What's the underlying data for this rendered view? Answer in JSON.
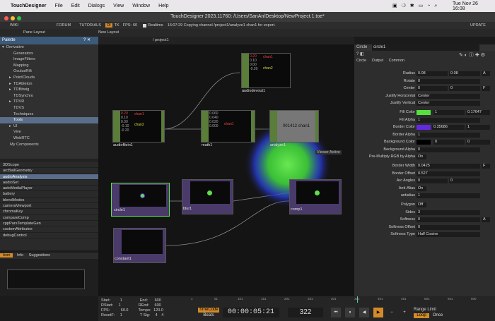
{
  "menubar": {
    "app": "TouchDesigner",
    "items": [
      "File",
      "Edit",
      "Dialogs",
      "View",
      "Window",
      "Help"
    ],
    "datetime": "Tue Nov 26  16:08"
  },
  "title": "TouchDesigner 2023.11760: /Users/SanAn/Desktop/NewProject.1.toe*",
  "toolbar": {
    "wiki": "WIKI",
    "forum": "FORUM",
    "tutorials": "TUTORIALS",
    "oi": "OI",
    "tk": "TK",
    "fps_label": "FPS:",
    "fps": "60",
    "realtime": "Realtime",
    "status": "16:07:29 Copying channel /project1/analyze1 chan1 for export.",
    "update": "UPDATE"
  },
  "toolbar2": {
    "pane_layout": "Pane Layout",
    "new_layout": "New Layout",
    "path": "/ project1"
  },
  "palette": {
    "title": "Palette",
    "items": [
      {
        "label": "Derivative",
        "indent": 0,
        "arrow": "▾"
      },
      {
        "label": "Generators",
        "indent": 2
      },
      {
        "label": "ImageFilters",
        "indent": 2
      },
      {
        "label": "Mapping",
        "indent": 2
      },
      {
        "label": "OculusRift",
        "indent": 2
      },
      {
        "label": "PointClouds",
        "indent": 2,
        "arrow": "▸"
      },
      {
        "label": "TDAbleton",
        "indent": 2,
        "arrow": "▸"
      },
      {
        "label": "TDBitwig",
        "indent": 2,
        "arrow": "▸"
      },
      {
        "label": "TDSynchro",
        "indent": 2
      },
      {
        "label": "TDVR",
        "indent": 2,
        "arrow": "▸"
      },
      {
        "label": "TDVS",
        "indent": 2
      },
      {
        "label": "Techniques",
        "indent": 2
      },
      {
        "label": "Tools",
        "indent": 2,
        "selected": true
      },
      {
        "label": "UI",
        "indent": 2,
        "arrow": "▸"
      },
      {
        "label": "Vive",
        "indent": 2
      },
      {
        "label": "WebRTC",
        "indent": 2
      },
      {
        "label": "My Components",
        "indent": 1
      }
    ]
  },
  "components": [
    "3DScope",
    "arcBallGeometry",
    "audioAnalysis",
    "audioSet",
    "autoMediaPlayer",
    "battery",
    "blendModes",
    "cameraViewport",
    "chromaKey",
    "compareComp",
    "cppParsTemplateGen",
    "customAttributes",
    "debugControl"
  ],
  "icon_tabs": [
    "Icon",
    "Info",
    "Suggestions"
  ],
  "nodes": {
    "audiodevout1": "audiodevout1",
    "audiofilein1": "audiofilein1",
    "math1": "math1",
    "analyze1": "analyze1",
    "analyze_val": "001412 chan1",
    "viewer_active": "Viewer Active",
    "circle1": "circle1",
    "blur1": "blur1",
    "comp1": "comp1",
    "constant1": "constant1",
    "chan1": "chan1",
    "chan2": "chan2",
    "v020": "0.20",
    "v010": "0.10",
    "v000": "0.00",
    "v_020": "-0.20",
    "v_010": "-0.10",
    "m060": "0.060",
    "m040": "0.040",
    "m020": "0.020",
    "m000": "0.000"
  },
  "params": {
    "op": "Circle",
    "name": "circle1",
    "tabs": [
      "Circle",
      "Output",
      "Common"
    ],
    "rows": [
      {
        "label": "Radius",
        "v1": "0.08",
        "v2": "0.08",
        "u": "A"
      },
      {
        "label": "Rotate",
        "v1": "0",
        "v2": "",
        "u": ""
      },
      {
        "label": "Center",
        "v1": "0",
        "v2": "0",
        "u": "F"
      },
      {
        "label": "Justify Horizontal",
        "v1": "Center",
        "v2": "",
        "u": ""
      },
      {
        "label": "Justify Vertical",
        "v1": "Center",
        "v2": "",
        "u": ""
      },
      {
        "label": "Fill Color",
        "v1": "",
        "v2": "1",
        "v3": "0.17647",
        "u": ""
      },
      {
        "label": "Fill Alpha",
        "v1": "1",
        "v2": "",
        "u": ""
      },
      {
        "label": "Border Color",
        "v1": "0.35686",
        "v2": "1",
        "u": ""
      },
      {
        "label": "Border Alpha",
        "v1": "1",
        "v2": "",
        "u": ""
      },
      {
        "label": "Background Color",
        "v1": "",
        "v2": "0",
        "v3": "0",
        "u": ""
      },
      {
        "label": "Background Alpha",
        "v1": "0",
        "v2": "",
        "u": ""
      },
      {
        "label": "Pre-Multiply RGB by Alpha",
        "v1": "On",
        "v2": "",
        "u": ""
      },
      {
        "label": "Border Width",
        "v1": "0.0425",
        "v2": "",
        "u": "F"
      },
      {
        "label": "Border Offset",
        "v1": "0.527",
        "v2": "",
        "u": ""
      },
      {
        "label": "Arc Angles",
        "v1": "0",
        "v2": "0",
        "u": ""
      },
      {
        "label": "Anti-Alias",
        "v1": "On",
        "v2": "",
        "u": ""
      },
      {
        "label": "antialias",
        "v1": "1",
        "v2": "",
        "u": ""
      },
      {
        "label": "Polygon",
        "v1": "Off",
        "v2": "",
        "u": ""
      },
      {
        "label": "Sides",
        "v1": "3",
        "v2": "",
        "u": ""
      },
      {
        "label": "Softness",
        "v1": "0",
        "v2": "",
        "u": "A"
      },
      {
        "label": "Softness Offset",
        "v1": "0",
        "v2": "",
        "u": ""
      },
      {
        "label": "Softness Type",
        "v1": "Half Cosine",
        "v2": "",
        "u": ""
      }
    ],
    "fill_color": "#55e03e",
    "border_color": "#6428e0",
    "bg_color": "#000000"
  },
  "timeline": {
    "start_l": "Start:",
    "start": "1",
    "end_l": "End:",
    "end": "600",
    "rstart_l": "RStart:",
    "rstart": "1",
    "rend_l": "REnd:",
    "rend": "600",
    "fps_l": "FPS:",
    "fps": "60.0",
    "tempo_l": "Tempo:",
    "tempo": "120.0",
    "resetf_l": "ResetF:",
    "resetf": "1",
    "tsig_l": "T Sig:",
    "tsig1": "4",
    "tsig2": "4",
    "timecode": "TimeCode",
    "beats": "Beats",
    "time": "00:00:05:21",
    "frame": "322",
    "range_limit": "Range Limit",
    "loop": "Loop",
    "once": "Once",
    "ticks": [
      "1",
      "51",
      "101",
      "151",
      "201",
      "251",
      "301",
      "351",
      "401",
      "451",
      "501",
      "551",
      "600"
    ]
  }
}
